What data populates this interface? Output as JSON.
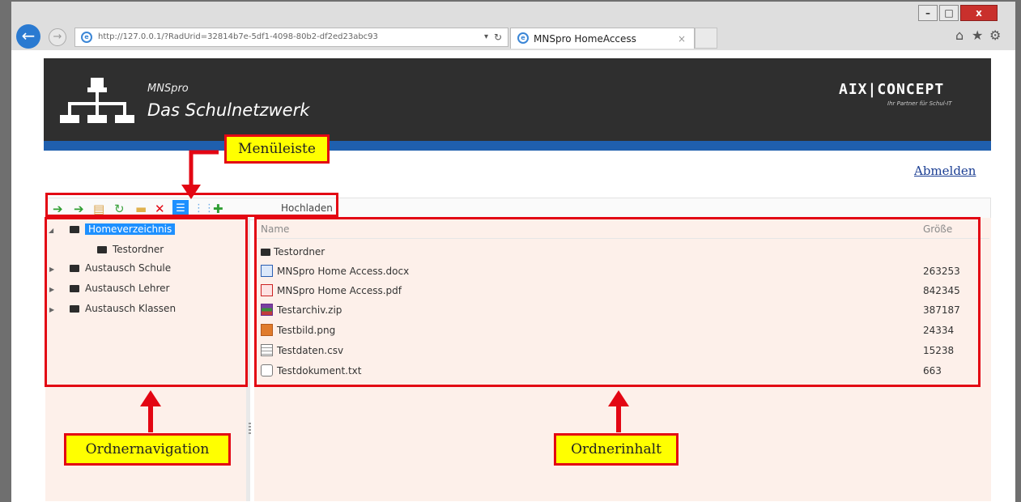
{
  "browser": {
    "back_icon": "back-arrow-icon",
    "forward_icon": "forward-arrow-icon",
    "address": "http://127.0.0.1/?RadUrid=32814b7e-5df1-4098-80b2-df2ed23abc93",
    "tab_title": "MNSpro HomeAccess",
    "tab_close": "×",
    "window_controls": {
      "minimize": "–",
      "maximize": "□",
      "close": "x"
    }
  },
  "header": {
    "brand_small": "MNSpro",
    "brand_large": "Das Schulnetzwerk",
    "logo_text": "AIX|CONCEPT",
    "logo_tagline": "Ihr Partner für Schul-IT"
  },
  "logout_label": "Abmelden",
  "toolbar": {
    "upload_label": "Hochladen",
    "icons": [
      "back-icon",
      "forward-icon",
      "open-folder-icon",
      "refresh-icon",
      "new-folder-icon",
      "delete-icon",
      "list-view-icon",
      "thumbnail-view-icon",
      "upload-icon"
    ]
  },
  "tree": {
    "items": [
      {
        "label": "Homeverzeichnis",
        "selected": true
      },
      {
        "label": "Testordner"
      },
      {
        "label": "Austausch Schule"
      },
      {
        "label": "Austausch Lehrer"
      },
      {
        "label": "Austausch Klassen"
      }
    ]
  },
  "files": {
    "col_name": "Name",
    "col_size": "Größe",
    "rows": [
      {
        "name": "Testordner",
        "size": "",
        "icon": "folder-icon"
      },
      {
        "name": "MNSpro Home Access.docx",
        "size": "263253",
        "icon": "word-doc-icon"
      },
      {
        "name": "MNSpro Home Access.pdf",
        "size": "842345",
        "icon": "pdf-icon"
      },
      {
        "name": "Testarchiv.zip",
        "size": "387187",
        "icon": "zip-archive-icon"
      },
      {
        "name": "Testbild.png",
        "size": "24334",
        "icon": "image-icon"
      },
      {
        "name": "Testdaten.csv",
        "size": "15238",
        "icon": "csv-table-icon"
      },
      {
        "name": "Testdokument.txt",
        "size": "663",
        "icon": "text-file-icon"
      }
    ]
  },
  "callouts": {
    "menubar": "Menüleiste",
    "folder_nav": "Ordnernavigation",
    "folder_content": "Ordnerinhalt"
  },
  "colors": {
    "accent_red": "#e30613",
    "callout_yellow": "#ffff00",
    "selection_blue": "#1e90ff",
    "header_dark": "#2f2f2f",
    "header_stripe": "#1f5fae"
  }
}
